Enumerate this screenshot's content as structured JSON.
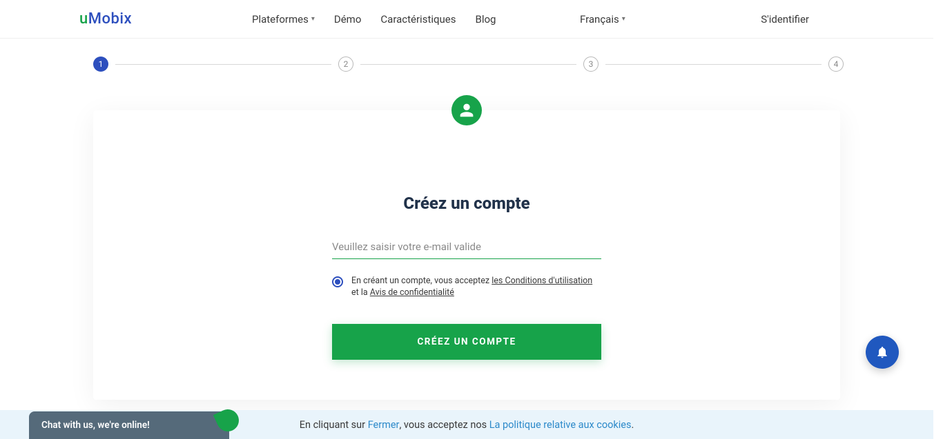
{
  "header": {
    "logo_u": "u",
    "logo_m": "Mobix",
    "nav": {
      "platforms": "Plateformes",
      "demo": "Démo",
      "features": "Caractéristiques",
      "blog": "Blog",
      "language": "Français",
      "login": "S'identifier"
    }
  },
  "steps": {
    "s1": "1",
    "s2": "2",
    "s3": "3",
    "s4": "4"
  },
  "form": {
    "title": "Créez un compte",
    "email_value": "",
    "email_placeholder": "Veuillez saisir votre e-mail valide",
    "consent_prefix": "En créant un compte, vous acceptez ",
    "consent_terms": "les Conditions d'utilisation",
    "consent_mid": " et la ",
    "consent_privacy": "Avis de confidentialité",
    "cta": "CRÉEZ UN COMPTE"
  },
  "chat": {
    "label": "Chat with us, we're online!"
  },
  "cookie": {
    "prefix": "En cliquant sur ",
    "close": "Fermer",
    "mid": " , vous acceptez nos",
    "policy": "La politique relative aux cookies",
    "suffix": " ."
  }
}
